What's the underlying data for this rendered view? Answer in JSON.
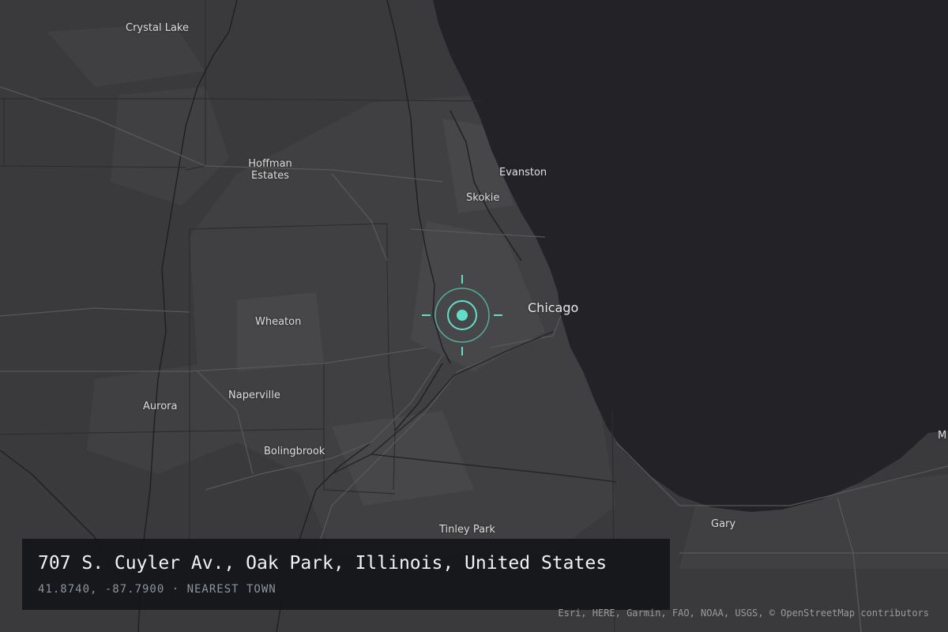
{
  "map": {
    "style_colors": {
      "land": "#3a3a3c",
      "urban": "#444446",
      "water": "#232227",
      "roads": "#565658",
      "rivers": "#1e1e20",
      "marker": "#5fe0c6"
    },
    "cities": [
      {
        "id": "crystal-lake",
        "label": "Crystal Lake"
      },
      {
        "id": "hoffman-estates",
        "label": "Hoffman Estates",
        "line1": "Hoffman",
        "line2": "Estates"
      },
      {
        "id": "evanston",
        "label": "Evanston"
      },
      {
        "id": "skokie",
        "label": "Skokie"
      },
      {
        "id": "chicago",
        "label": "Chicago"
      },
      {
        "id": "wheaton",
        "label": "Wheaton"
      },
      {
        "id": "naperville",
        "label": "Naperville"
      },
      {
        "id": "aurora",
        "label": "Aurora"
      },
      {
        "id": "bolingbrook",
        "label": "Bolingbrook"
      },
      {
        "id": "tinley-park",
        "label": "Tinley Park"
      },
      {
        "id": "gary",
        "label": "Gary"
      },
      {
        "id": "m-edge",
        "label": "M"
      }
    ],
    "marker_icon": "crosshair-target-icon"
  },
  "location": {
    "address": "707 S. Cuyler Av., Oak Park, Illinois, United States",
    "details": "41.8740, -87.7900 · NEAREST TOWN"
  },
  "attribution": "Esri, HERE, Garmin, FAO, NOAA, USGS, © OpenStreetMap contributors"
}
